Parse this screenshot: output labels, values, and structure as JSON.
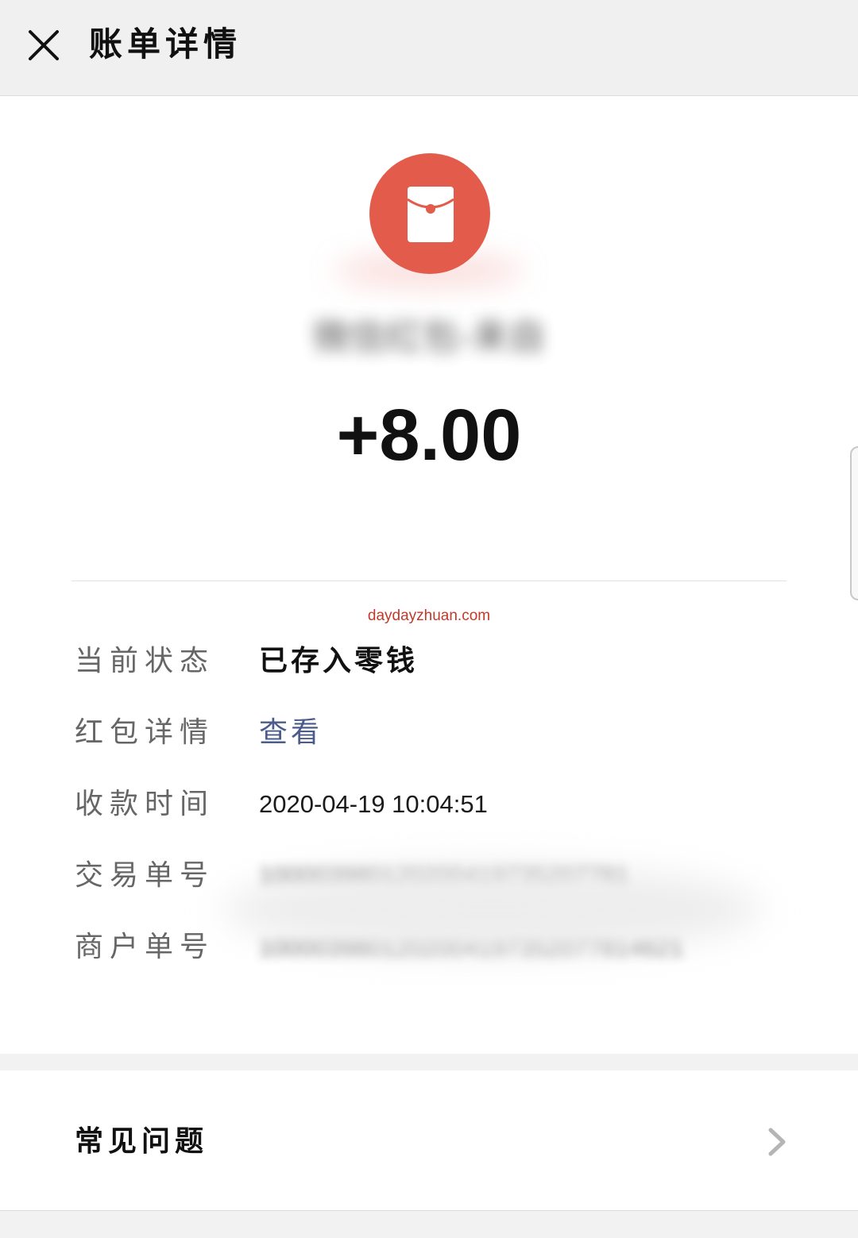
{
  "header": {
    "title": "账单详情",
    "close_icon": "close-icon"
  },
  "summary": {
    "icon": "red-envelope-icon",
    "icon_color": "#e35b4a",
    "payer_name_redacted": "微信红包-来自",
    "amount": "+8.00"
  },
  "watermark": "daydayzhuan.com",
  "details": {
    "status": {
      "label": "当前状态",
      "value": "已存入零钱"
    },
    "envelope": {
      "label": "红包详情",
      "value": "查看"
    },
    "time": {
      "label": "收款时间",
      "value": "2020-04-19 10:04:51"
    },
    "transaction": {
      "label": "交易单号",
      "value": "100003980120200419735207781"
    },
    "merchant": {
      "label": "商户单号",
      "value": "1000039801202004197352077814621"
    }
  },
  "faq": {
    "label": "常见问题",
    "icon": "chevron-right-icon"
  },
  "colors": {
    "accent_red": "#e35b4a",
    "link_blue": "#4a5b8c",
    "watermark_red": "#c0392b"
  }
}
